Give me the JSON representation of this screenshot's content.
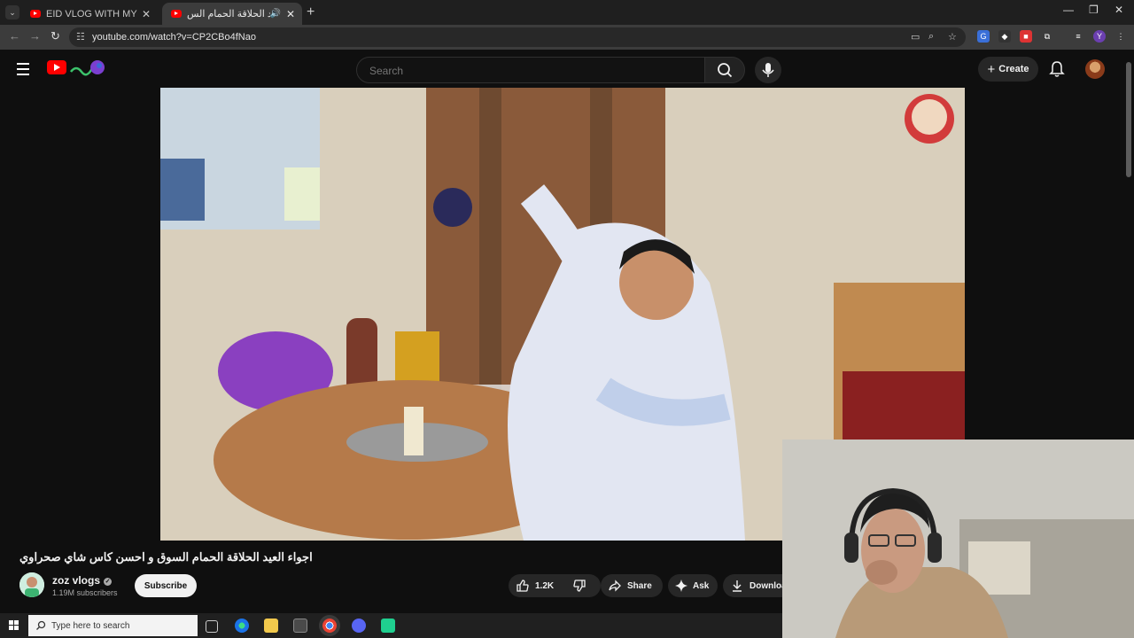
{
  "browser": {
    "tabs": [
      {
        "title": "EID VLOG WITH MY FAMILY I 🙂"
      },
      {
        "title": "اجواء العيد الحلاقة الحمام الس...",
        "active": true
      }
    ],
    "url": "youtube.com/watch?v=CP2CBo4fNao"
  },
  "youtube": {
    "search_placeholder": "Search",
    "create_label": "Create"
  },
  "video": {
    "title": "اجواء العيد الحلاقة الحمام السوق و احسن كاس شاي صحراوي",
    "channel_name": "zoz vlogs",
    "subscribers": "1.19M subscribers",
    "subscribe_label": "Subscribe",
    "likes": "1.2K",
    "share_label": "Share",
    "ask_label": "Ask",
    "download_label": "Download"
  },
  "taskbar": {
    "search_placeholder": "Type here to search"
  },
  "colors": {
    "youtube_red": "#ff0000",
    "page_bg": "#0f0f0f",
    "chip_bg": "#272727"
  }
}
